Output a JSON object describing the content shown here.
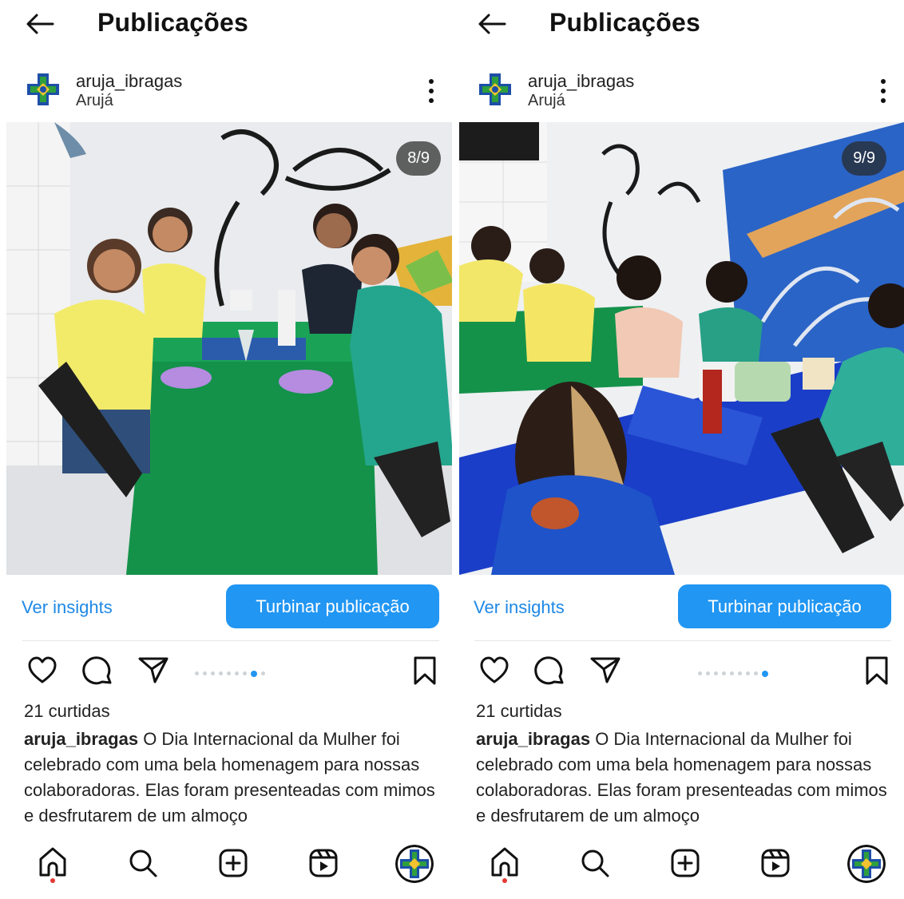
{
  "screens": [
    {
      "header": {
        "title": "Publicações"
      },
      "post": {
        "username": "aruja_ibragas",
        "location": "Arujá",
        "counter": "8/9",
        "insights_label": "Ver insights",
        "boost_label": "Turbinar publicação",
        "likes": "21 curtidas",
        "caption_user": "aruja_ibragas",
        "caption_text": "O Dia Internacional da Mulher foi celebrado com uma bela homenagem para nossas colaboradoras. Elas foram presenteadas com mimos e desfrutarem de um almoço",
        "carousel": {
          "count": 9,
          "active": 8
        }
      }
    },
    {
      "header": {
        "title": "Publicações"
      },
      "post": {
        "username": "aruja_ibragas",
        "location": "Arujá",
        "counter": "9/9",
        "insights_label": "Ver insights",
        "boost_label": "Turbinar publicação",
        "likes": "21 curtidas",
        "caption_user": "aruja_ibragas",
        "caption_text": "O Dia Internacional da Mulher foi celebrado com uma bela homenagem para nossas colaboradoras. Elas foram presenteadas com mimos e desfrutarem de um almoço",
        "carousel": {
          "count": 9,
          "active": 9
        }
      }
    }
  ],
  "icons": {
    "back": "back-arrow-icon",
    "more": "more-vertical-icon",
    "like": "heart-icon",
    "comment": "comment-icon",
    "share": "share-icon",
    "save": "bookmark-icon",
    "home": "home-icon",
    "search": "search-icon",
    "create": "create-icon",
    "reels": "reels-icon"
  },
  "colors": {
    "accent": "#2196f3",
    "link": "#1e88e5",
    "text": "#222222",
    "notification": "#e53935"
  }
}
